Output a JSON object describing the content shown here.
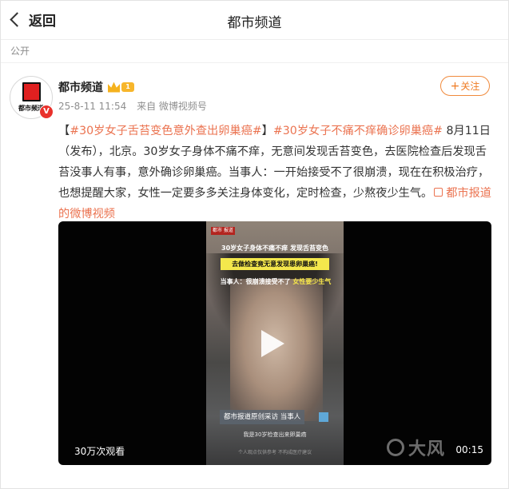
{
  "topbar": {
    "back_label": "返回",
    "title": "都市频道"
  },
  "visibility": "公开",
  "post": {
    "author": "都市频道",
    "avatar_text": "都市频道",
    "verified_mark": "V",
    "vip_level": "1",
    "date": "25-8-11 11:54",
    "source": "来自 微博视频号",
    "follow_label": "关注",
    "content": {
      "bracket_open": "【",
      "tag1": "#30岁女子舌苔变色意外查出卵巢癌#",
      "bracket_close": "】",
      "tag2": "#30岁女子不痛不痒确诊卵巢癌#",
      "body": " 8月11日（发布），北京。30岁女子身体不痛不痒，无意间发现舌苔变色，去医院检查后发现舌苔没事人有事，意外确诊卵巢癌。当事人：一开始接受不了很崩溃，现在在积极治疗，也想提醒大家，女性一定要多多关注身体变化，定时检查，少熬夜少生气。",
      "link_text": "都市报道的微博视频"
    },
    "video": {
      "views": "30万次观看",
      "duration": "00:15",
      "watermark": "大风",
      "frame": {
        "source_badge": "都市\n报道",
        "caption1": "30岁女子身体不痛不痒 发现舌苔变色",
        "caption2": "去做检查竟无意发现患卵巢癌!",
        "caption3_a": "当事人：很崩溃接受不了",
        "caption3_b": "女性要少生气",
        "caption4": "都市报道原创采访 当事人",
        "caption5": "我是30岁检查出来卵巢癌",
        "caption6": "个人观点仅供参考 不构成医疗建议"
      }
    }
  }
}
